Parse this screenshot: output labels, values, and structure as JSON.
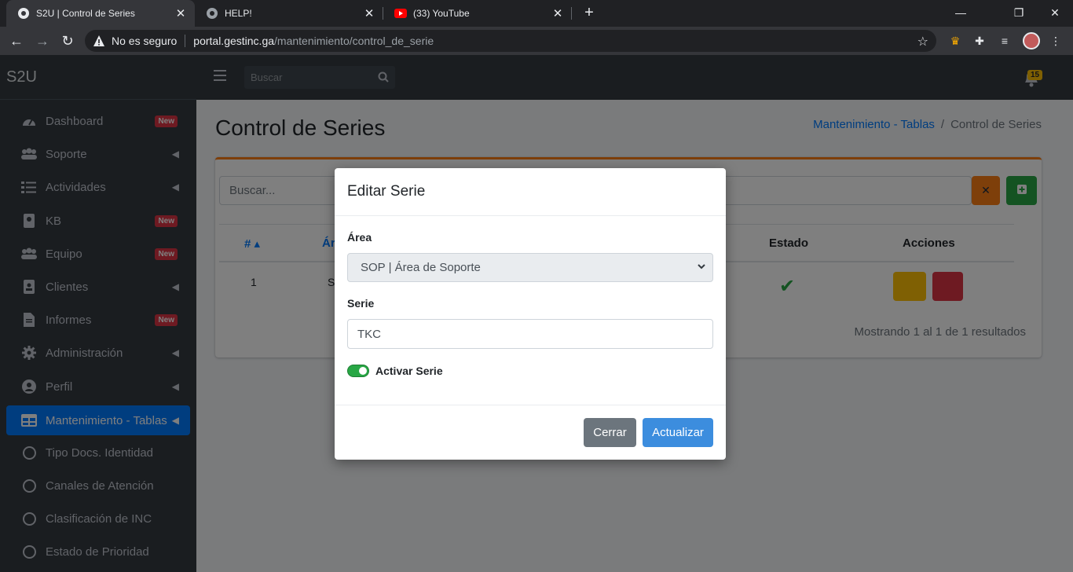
{
  "browser": {
    "tabs": [
      {
        "title": "S2U | Control de Series",
        "active": true
      },
      {
        "title": "HELP!",
        "active": false
      },
      {
        "title": "(33) YouTube",
        "active": false
      }
    ],
    "address": {
      "security": "No es seguro",
      "host": "portal.gestinc.ga",
      "path": "/mantenimiento/control_de_serie"
    }
  },
  "app": {
    "brand": "S2U",
    "search_placeholder": "Buscar",
    "notifications_count": "15"
  },
  "sidebar": {
    "items": [
      {
        "label": "Dashboard",
        "icon": "dashboard-icon",
        "badge": "New"
      },
      {
        "label": "Soporte",
        "icon": "users-icon",
        "chevron": true
      },
      {
        "label": "Actividades",
        "icon": "tasks-icon",
        "chevron": true
      },
      {
        "label": "KB",
        "icon": "book-icon",
        "badge": "New"
      },
      {
        "label": "Equipo",
        "icon": "users-icon",
        "badge": "New"
      },
      {
        "label": "Clientes",
        "icon": "address-book-icon",
        "chevron": true
      },
      {
        "label": "Informes",
        "icon": "file-icon",
        "badge": "New"
      },
      {
        "label": "Administración",
        "icon": "gear-icon",
        "chevron": true
      },
      {
        "label": "Perfil",
        "icon": "user-circle-icon",
        "chevron": true
      },
      {
        "label": "Mantenimiento - Tablas",
        "icon": "table-icon",
        "chevron": true,
        "active": true
      },
      {
        "label": "Tipo Docs. Identidad",
        "icon": "circle-icon"
      },
      {
        "label": "Canales de Atención",
        "icon": "circle-icon"
      },
      {
        "label": "Clasificación de INC",
        "icon": "circle-icon"
      },
      {
        "label": "Estado de Prioridad",
        "icon": "circle-icon"
      }
    ]
  },
  "page": {
    "title": "Control de Series",
    "breadcrumb": {
      "parent": "Mantenimiento - Tablas",
      "separator": "/",
      "current": "Control de Series"
    },
    "search_placeholder": "Buscar...",
    "table": {
      "headers": {
        "num": "#",
        "area": "Ár",
        "estado": "Estado",
        "acciones": "Acciones"
      },
      "rows": [
        {
          "num": "1",
          "area": "S"
        }
      ]
    },
    "showing": "Mostrando 1 al 1 de 1 resultados"
  },
  "modal": {
    "title": "Editar Serie",
    "area_label": "Área",
    "area_value": "SOP | Área de Soporte",
    "serie_label": "Serie",
    "serie_value": "TKC",
    "toggle_label": "Activar Serie",
    "close_label": "Cerrar",
    "update_label": "Actualizar"
  },
  "colors": {
    "accent": "#007bff",
    "orange": "#fd7e14",
    "green": "#28a745",
    "danger": "#dc3545",
    "warning": "#ffc107"
  }
}
